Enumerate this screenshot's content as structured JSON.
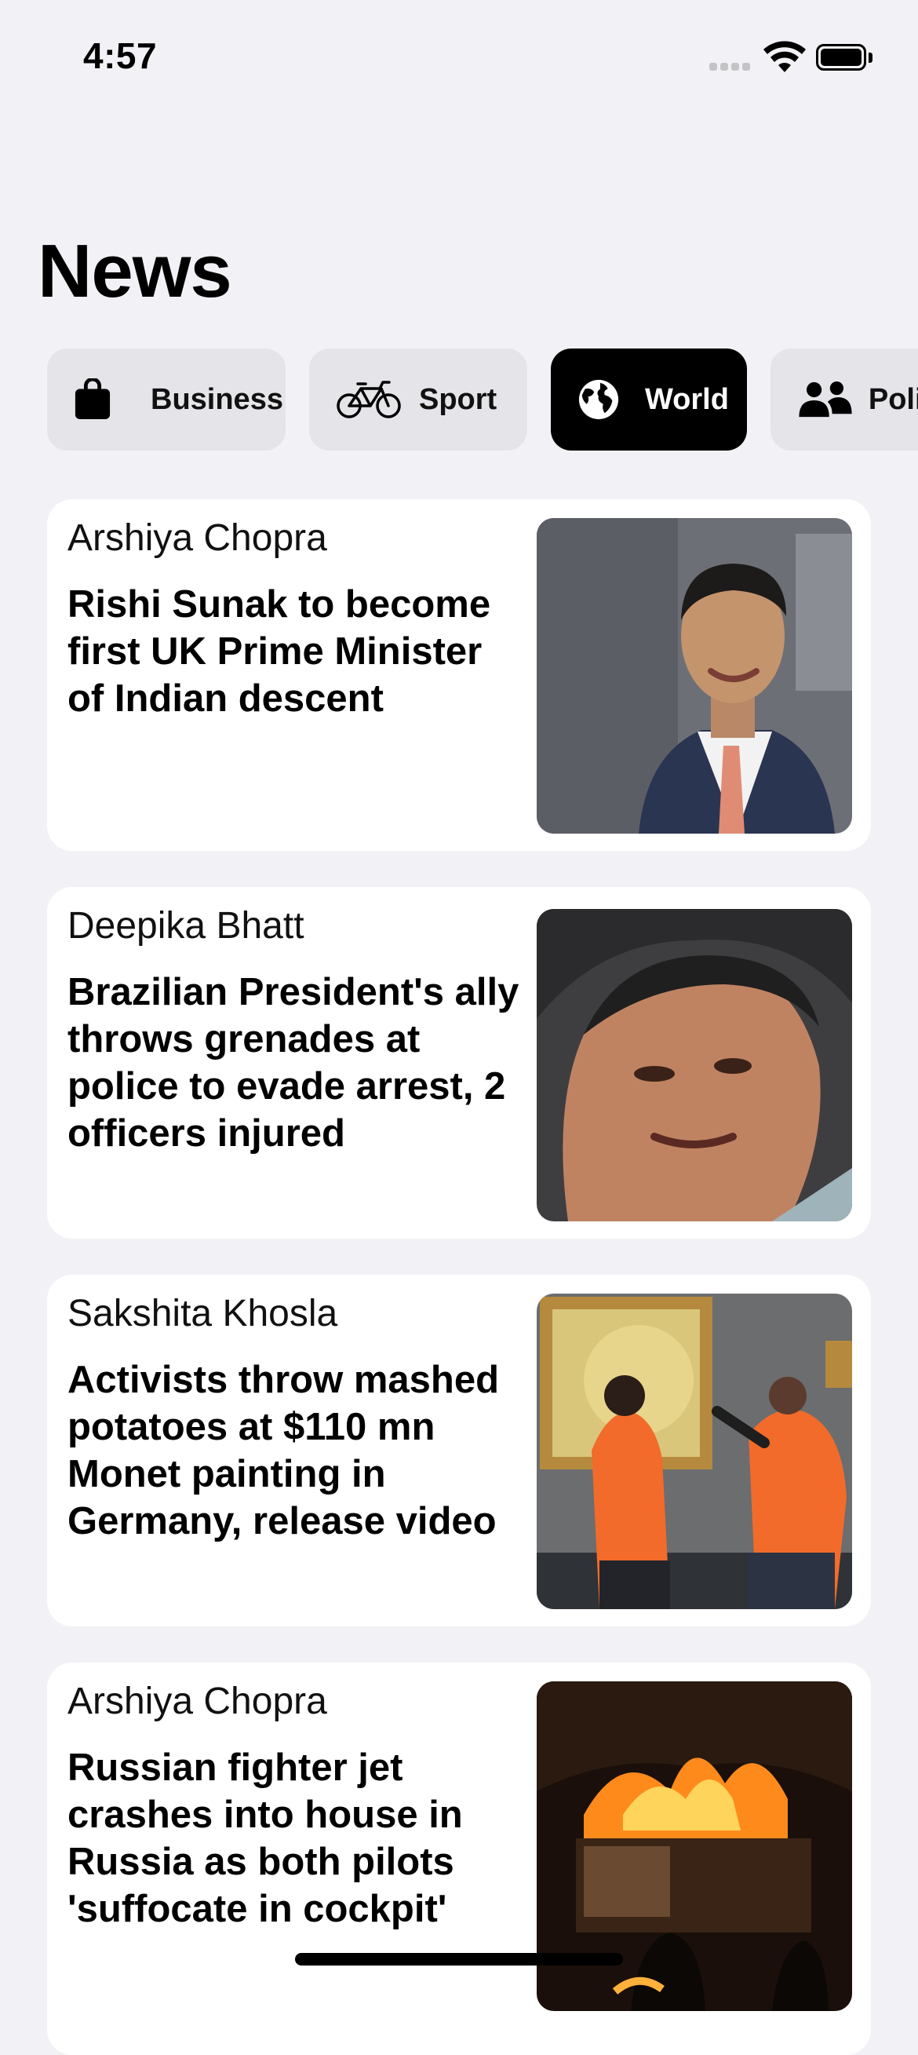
{
  "status_bar": {
    "time": "4:57"
  },
  "page": {
    "title": "News"
  },
  "categories": [
    {
      "label": "Business",
      "icon": "shopping-bag-icon",
      "active": false
    },
    {
      "label": "Sport",
      "icon": "bicycle-icon",
      "active": false
    },
    {
      "label": "World",
      "icon": "globe-icon",
      "active": true
    },
    {
      "label": "Politics",
      "icon": "people-icon",
      "active": false
    }
  ],
  "articles": [
    {
      "author": "Arshiya Chopra",
      "headline": "Rishi Sunak to become first UK Prime Minister of Indian descent",
      "image": "portrait-man-suit-photo"
    },
    {
      "author": "Deepika Bhatt",
      "headline": "Brazilian President's ally throws grenades at police to evade arrest, 2 officers injured",
      "image": "closeup-older-man-photo"
    },
    {
      "author": "Sakshita Khosla",
      "headline": "Activists throw mashed potatoes at $110 mn Monet painting in Germany, release video",
      "image": "activists-museum-photo"
    },
    {
      "author": "Arshiya Chopra",
      "headline": "Russian fighter jet crashes into house in Russia as both pilots 'suffocate in cockpit'",
      "image": "house-fire-night-photo"
    }
  ],
  "colors": {
    "background": "#f2f2f6",
    "chip": "#e4e4e9",
    "chip_active": "#000000",
    "card": "#ffffff"
  }
}
